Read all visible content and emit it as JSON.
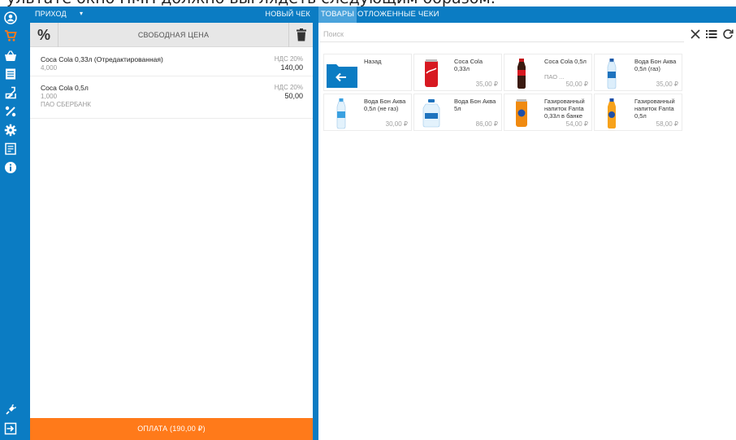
{
  "top_caption": "ультате окно ПМП должно выглядеть следующим образом:",
  "colors": {
    "primary": "#0b7cc3",
    "active_tab": "#4aa3dc",
    "pay_button": "#ff7a1a",
    "cart_active": "#ff7a1a"
  },
  "rail": {
    "icons": [
      "user-icon",
      "cart-icon",
      "basket-icon",
      "document-icon",
      "flask-icon",
      "percent-icon",
      "gear-icon",
      "report-icon",
      "info-icon",
      "plug-icon",
      "logout-icon"
    ]
  },
  "receipt": {
    "mode_label": "ПРИХОД",
    "mode_caret": "▾",
    "new_check_label": "НОВЫЙ ЧЕК",
    "percent_symbol": "%",
    "free_price_label": "СВОБОДНАЯ ЦЕНА",
    "items": [
      {
        "name": "Coca Cola 0,33л (Отредактированная)",
        "qty": "4,000",
        "org": "",
        "vat": "НДС 20%",
        "sum": "140,00"
      },
      {
        "name": "Coca Cola 0,5л",
        "qty": "1,000",
        "org": "ПАО СБЕРБАНК",
        "vat": "НДС 20%",
        "sum": "50,00"
      }
    ],
    "pay_label": "ОПЛАТА (190,00 ₽)"
  },
  "products": {
    "tabs": [
      {
        "label": "ТОВАРЫ",
        "active": true
      },
      {
        "label": "ОТЛОЖЕННЫЕ ЧЕКИ",
        "active": false
      }
    ],
    "search_placeholder": "Поиск",
    "back_label": "Назад",
    "tiles": [
      {
        "name": "Coca Cola 0,33л",
        "org": "",
        "price": "35,00 ₽",
        "image": "cola-can"
      },
      {
        "name": "Coca Cola 0,5л",
        "org": "ПАО ...",
        "price": "50,00 ₽",
        "image": "cola-bottle"
      },
      {
        "name": "Вода Бон Аква 0,5л (газ)",
        "org": "",
        "price": "35,00 ₽",
        "image": "water-bottle"
      },
      {
        "name": "Вода Бон Аква 0,5л (не газ)",
        "org": "",
        "price": "30,00 ₽",
        "image": "water-bottle"
      },
      {
        "name": "Вода Бон Аква 5л",
        "org": "",
        "price": "86,00 ₽",
        "image": "water-jug"
      },
      {
        "name": "Газированный напиток Fanta 0,33л в банке",
        "org": "",
        "price": "54,00 ₽",
        "image": "fanta-can"
      },
      {
        "name": "Газированный напиток Fanta 0,5л",
        "org": "",
        "price": "58,00 ₽",
        "image": "fanta-bottle"
      }
    ]
  }
}
